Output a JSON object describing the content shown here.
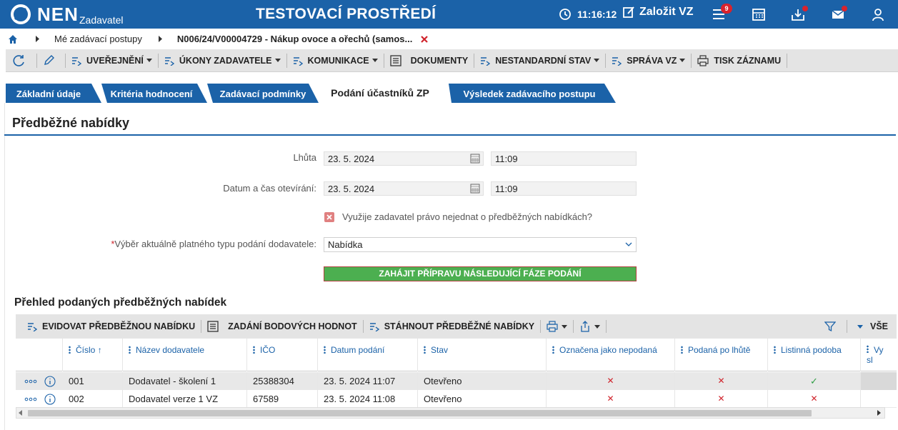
{
  "header": {
    "logo_text": "NEN",
    "logo_sub": "Zadavatel",
    "env_title": "TESTOVACÍ PROSTŘEDÍ",
    "clock_time": "11:16:12",
    "create_label": "Založit VZ",
    "notification_count": "9",
    "colors": {
      "brand": "#1b62a8",
      "badge": "#d9232d"
    }
  },
  "breadcrumb": {
    "items": [
      "Mé zadávací postupy",
      "N006/24/V00004729 - Nákup ovoce a ořechů (samos..."
    ]
  },
  "toolbar": {
    "items": [
      {
        "label": "UVEŘEJNĚNÍ",
        "icon": "list-arrow-icon",
        "dropdown": true
      },
      {
        "label": "ÚKONY ZADAVATELE",
        "icon": "list-arrow-icon",
        "dropdown": true
      },
      {
        "label": "KOMUNIKACE",
        "icon": "list-arrow-icon",
        "dropdown": true
      },
      {
        "label": "DOKUMENTY",
        "icon": "document-icon",
        "dropdown": false
      },
      {
        "label": "NESTANDARDNÍ STAV",
        "icon": "list-arrow-icon",
        "dropdown": true
      },
      {
        "label": "SPRÁVA VZ",
        "icon": "list-arrow-icon",
        "dropdown": true
      },
      {
        "label": "TISK ZÁZNAMU",
        "icon": "printer-icon",
        "dropdown": false
      }
    ]
  },
  "tabs": [
    {
      "label": "Základní údaje",
      "active": false
    },
    {
      "label": "Kritéria hodnocení",
      "active": false
    },
    {
      "label": "Zadávací podmínky",
      "active": false
    },
    {
      "label": "Podání účastníků ZP",
      "active": true
    },
    {
      "label": "Výsledek zadávacího postupu",
      "active": false
    }
  ],
  "section": {
    "title": "Předběžné nabídky",
    "deadline_label": "Lhůta",
    "deadline_date": "23. 5. 2024",
    "deadline_time": "11:09",
    "opening_label": "Datum a čas otevírání:",
    "opening_date": "23. 5. 2024",
    "opening_time": "11:09",
    "checkbox_label": "Využije zadavatel právo nejednat o předběžných nabídkách?",
    "checkbox_checked": false,
    "select_required_mark": "*",
    "select_label": "Výběr aktuálně platného typu podání dodavatele:",
    "select_value": "Nabídka",
    "action_button": "ZAHÁJIT PŘÍPRAVU NÁSLEDUJÍCÍ FÁZE PODÁNÍ"
  },
  "grid": {
    "title": "Přehled podaných předběžných nabídek",
    "toolbar": {
      "record_label": "EVIDOVAT PŘEDBĚŽNOU NABÍDKU",
      "scores_label": "ZADÁNÍ BODOVÝCH HODNOT",
      "download_label": "STÁHNOUT PŘEDBĚŽNÉ NABÍDKY",
      "all_label": "VŠE"
    },
    "columns": [
      "Číslo",
      "Název dodavatele",
      "IČO",
      "Datum podání",
      "Stav",
      "Označena jako nepodaná",
      "Podaná po lhůtě",
      "Listinná podoba",
      "Vy sl"
    ],
    "sort_indicator": "↑",
    "rows": [
      {
        "cislo": "001",
        "nazev": "Dodavatel - školení 1",
        "ico": "25388304",
        "datum": "23. 5. 2024 11:07",
        "stav": "Otevřeno",
        "nepodana": "✕",
        "po_lhute": "✕",
        "listinna": "✓"
      },
      {
        "cislo": "002",
        "nazev": "Dodavatel verze 1 VZ",
        "ico": "67589",
        "datum": "23. 5. 2024 11:08",
        "stav": "Otevřeno",
        "nepodana": "✕",
        "po_lhute": "✕",
        "listinna": "✕"
      }
    ]
  }
}
